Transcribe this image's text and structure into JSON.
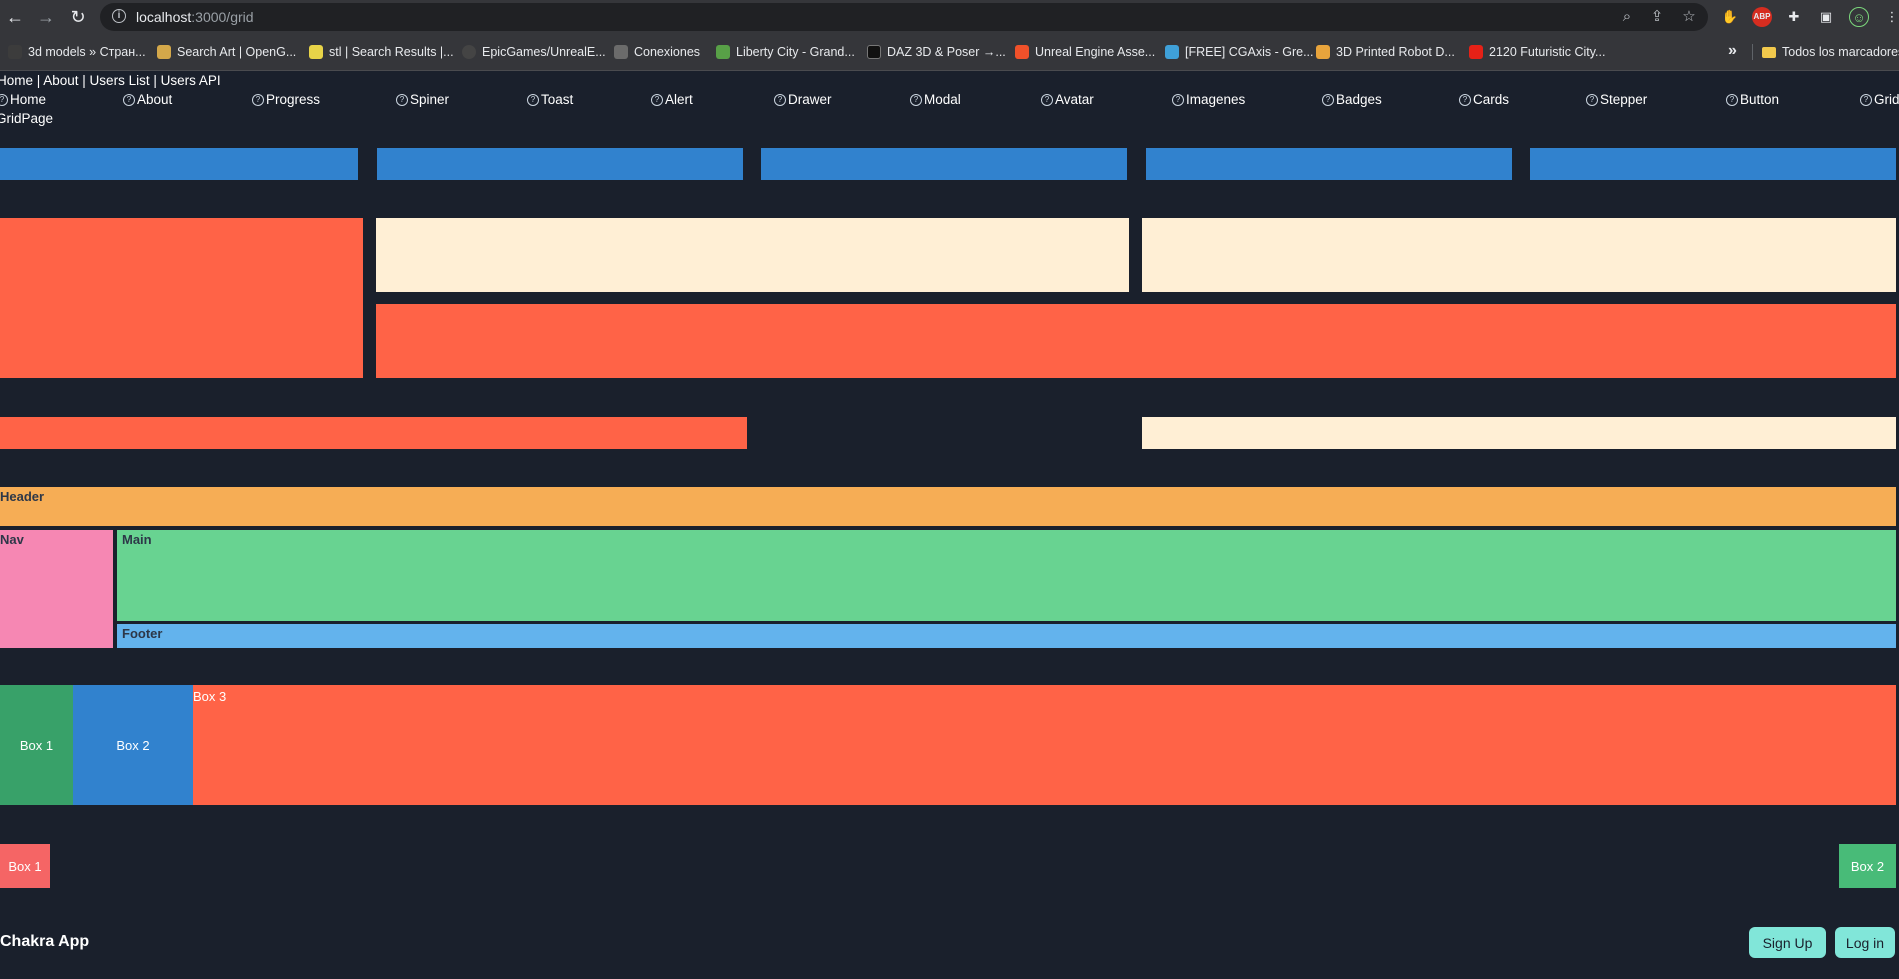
{
  "browser": {
    "url_host": "localhost",
    "url_path": ":3000/grid",
    "bookmarks": [
      {
        "label": "3d models » Стран...",
        "color": "#3c3c3c"
      },
      {
        "label": "Search Art | OpenG...",
        "color": "#d4a84a"
      },
      {
        "label": "stl | Search Results |...",
        "color": "#e8d448"
      },
      {
        "label": "EpicGames/UnrealE...",
        "color": "#444444"
      },
      {
        "label": "Conexiones",
        "color": "#6b6b6b"
      },
      {
        "label": "Liberty City - Grand...",
        "color": "#58a047"
      },
      {
        "label": "DAZ 3D & Poser →...",
        "color": "#111111"
      },
      {
        "label": "Unreal Engine Asse...",
        "color": "#f0512a"
      },
      {
        "label": "[FREE] CGAxis - Gre...",
        "color": "#3fa0d8"
      },
      {
        "label": "3D Printed Robot D...",
        "color": "#e8a43c"
      },
      {
        "label": "2120 Futuristic City...",
        "color": "#e62117"
      }
    ],
    "bookmarks_folder": "Todos los marcadores"
  },
  "app": {
    "top_links": "Home | About | Users List | Users API",
    "menu": [
      "Home",
      "About",
      "Progress",
      "Spiner",
      "Toast",
      "Alert",
      "Drawer",
      "Modal",
      "Avatar",
      "Imagenes",
      "Badges",
      "Cards",
      "Stepper",
      "Button",
      "Grid"
    ],
    "gridpage_label": "GridPage",
    "layout_labels": {
      "header": "Header",
      "nav": "Nav",
      "main": "Main",
      "footer": "Footer"
    },
    "box_row": {
      "box1": "Box 1",
      "box2": "Box 2",
      "box3": "Box 3"
    },
    "spacer_row": {
      "box1": "Box 1",
      "box2": "Box 2"
    },
    "footer_brand": "Chakra App",
    "buttons": {
      "signup": "Sign Up",
      "login": "Log in"
    }
  },
  "colors": {
    "bg": "#1a202c",
    "blue": "#3182ce",
    "tomato": "#ff6347",
    "papayawhip": "#ffefd5",
    "orange": "#f6ad55",
    "pink": "#f687b3",
    "green": "#68d391",
    "lightblue": "#63b3ed",
    "teal": "#81e6d9",
    "red": "#f56565",
    "green_dark": "#38a169",
    "green_box": "#48bb78"
  }
}
